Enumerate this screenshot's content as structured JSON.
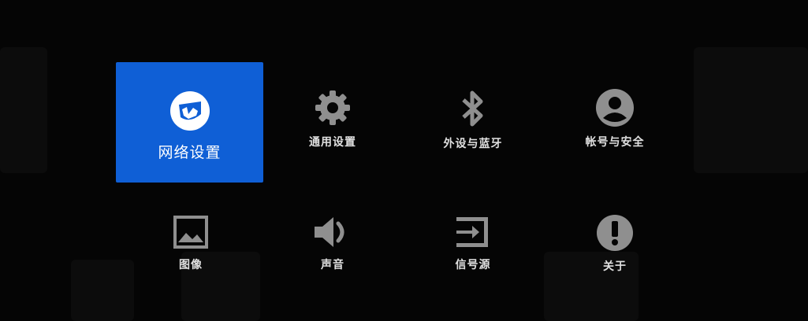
{
  "colors": {
    "background": "#050505",
    "selected": "#0f5fd6",
    "icon": "#8f8f8f"
  },
  "settings": {
    "row1": [
      {
        "label": "网络设置",
        "icon": "network-icon",
        "selected": true
      },
      {
        "label": "通用设置",
        "icon": "gear-icon",
        "selected": false
      },
      {
        "label": "外设与蓝牙",
        "icon": "bluetooth-icon",
        "selected": false
      },
      {
        "label": "帐号与安全",
        "icon": "account-icon",
        "selected": false
      }
    ],
    "row2": [
      {
        "label": "图像",
        "icon": "image-icon",
        "selected": false
      },
      {
        "label": "声音",
        "icon": "volume-icon",
        "selected": false
      },
      {
        "label": "信号源",
        "icon": "input-source-icon",
        "selected": false
      },
      {
        "label": "关于",
        "icon": "info-icon",
        "selected": false
      }
    ]
  }
}
